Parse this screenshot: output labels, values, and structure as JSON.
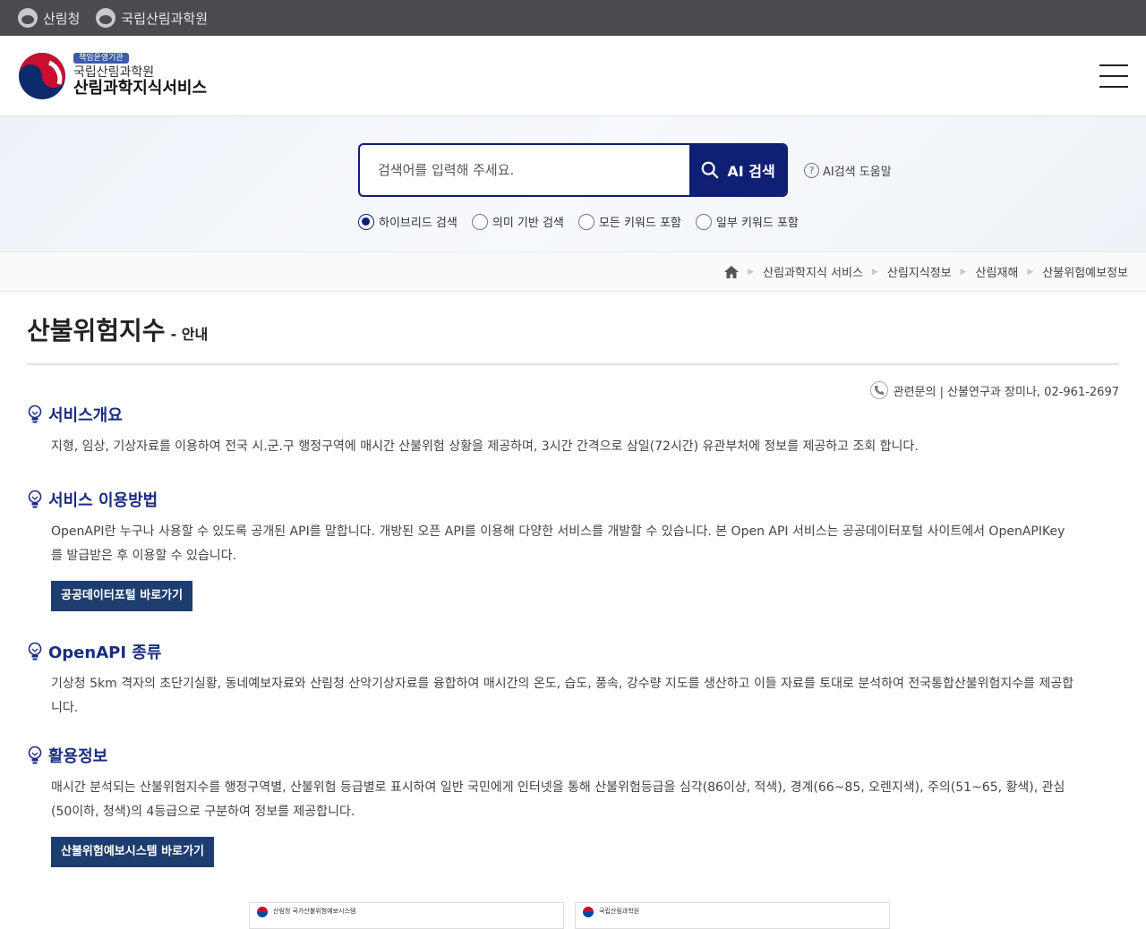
{
  "gov_bar": {
    "links": [
      "산림청",
      "국립산림과학원"
    ]
  },
  "header": {
    "badge": "책임운영기관",
    "org": "국립산림과학원",
    "service": "산림과학지식서비스"
  },
  "search": {
    "placeholder": "검색어를 입력해 주세요.",
    "button_label": "AI 검색",
    "help_label": "AI검색 도움말",
    "options": [
      {
        "label": "하이브리드 검색",
        "selected": true
      },
      {
        "label": "의미 기반 검색",
        "selected": false
      },
      {
        "label": "모든 키워드 포함",
        "selected": false
      },
      {
        "label": "일부 키워드 포함",
        "selected": false
      }
    ]
  },
  "breadcrumb": [
    "산림과학지식 서비스",
    "산림지식정보",
    "산림재해",
    "산불위험예보정보"
  ],
  "page": {
    "title": "산불위험지수",
    "subtitle": "- 안내",
    "contact": "관련문의 | 산불연구과 장미나, 02-961-2697"
  },
  "sections": [
    {
      "title": "서비스개요",
      "text": "지형, 임상, 기상자료를 이용하여 전국 시.군.구 행정구역에 매시간 산불위험 상황을 제공하며, 3시간 간격으로 삼일(72시간) 유관부처에 정보를 제공하고 조회 합니다."
    },
    {
      "title": "서비스 이용방법",
      "text": "OpenAPI란 누구나 사용할 수 있도록 공개된 API를 말합니다. 개방된 오픈 API를 이용해 다양한 서비스를 개발할 수 있습니다. 본 Open API 서비스는 공공데이터포털 사이트에서 OpenAPIKey를 발급받은 후 이용할 수 있습니다.",
      "button": "공공데이터포털 바로가기"
    },
    {
      "title": "OpenAPI 종류",
      "text": "기상청 5km 격자의 초단기실황, 동네예보자료와 산림청 산악기상자료를 융합하여 매시간의 온도, 습도, 풍속, 강수량 지도를 생산하고 이들 자료를 토대로 분석하여 전국통합산불위험지수를 제공합니다."
    },
    {
      "title": "활용정보",
      "text": "매시간 분석되는 산불위험지수를 행정구역별, 산불위험 등급별로 표시하여 일반 국민에게 인터넷을 통해 산불위험등급을 심각(86이상, 적색), 경계(66~85, 오렌지색), 주의(51~65, 황색), 관심(50이하, 청색)의 4등급으로 구분하여 정보를 제공합니다.",
      "button": "산불위험예보시스템 바로가기"
    }
  ],
  "thumbnails": [
    "산림청 국가산불위험예보시스템",
    "국립산림과학원"
  ],
  "colors": {
    "accent": "#0f1f73",
    "heading": "#1a2d80",
    "cta": "#1c3d6e"
  }
}
